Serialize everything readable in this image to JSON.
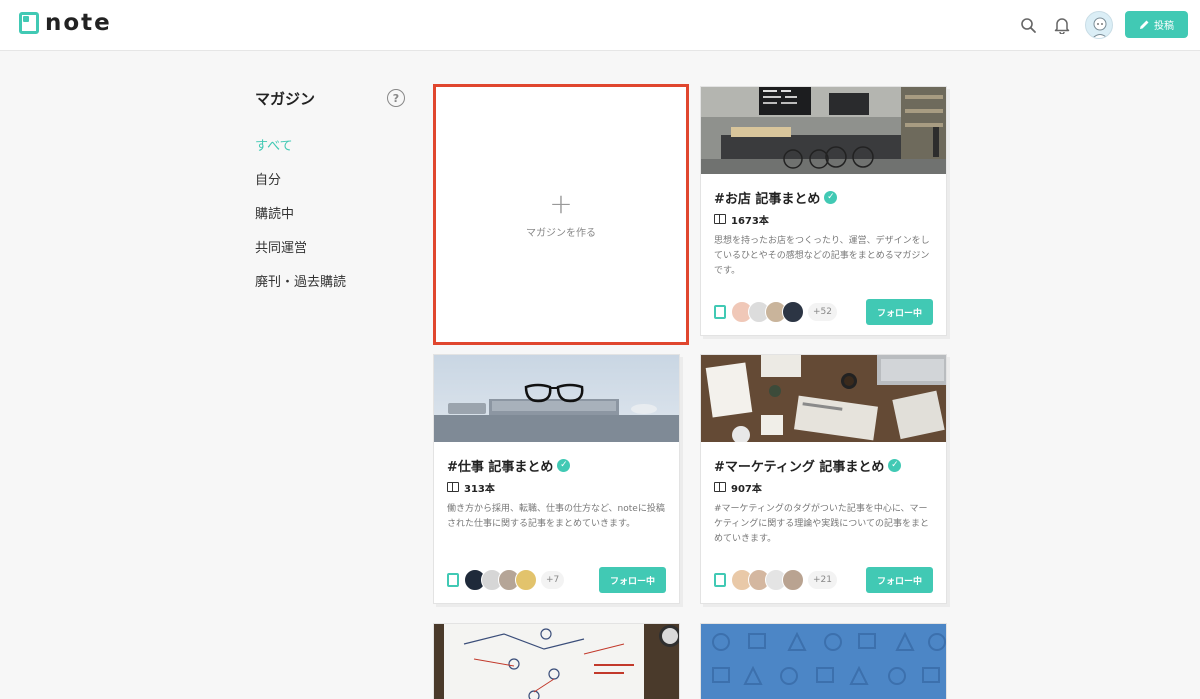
{
  "header": {
    "logo_text": "note",
    "post_button": "投稿",
    "accent_color": "#41c9b4"
  },
  "sidebar": {
    "title": "マガジン",
    "help_icon": "?",
    "items": [
      {
        "label": "すべて",
        "active": true
      },
      {
        "label": "自分"
      },
      {
        "label": "購読中"
      },
      {
        "label": "共同運営"
      },
      {
        "label": "廃刊・過去購読"
      }
    ]
  },
  "create_card": {
    "plus": "+",
    "label": "マガジンを作る"
  },
  "magazines": [
    {
      "title": "#お店 記事まとめ",
      "count": "1673本",
      "description": "思想を持ったお店をつくったり、運営、デザインをしているひとやその感想などの記事をまとめるマガジンです。",
      "member_count": "+52",
      "follow_label": "フォロー中",
      "image": "cafe-photo"
    },
    {
      "title": "#仕事 記事まとめ",
      "count": "313本",
      "description": "働き方から採用、転職、仕事の仕方など、noteに投稿された仕事に関する記事をまとめていきます。",
      "member_count": "+7",
      "follow_label": "フォロー中",
      "image": "glasses-laptop-photo"
    },
    {
      "title": "#マーケティング 記事まとめ",
      "count": "907本",
      "description": "#マーケティングのタグがついた記事を中心に、マーケティングに関する理論や実践についての記事をまとめていきます。",
      "member_count": "+21",
      "follow_label": "フォロー中",
      "image": "desk-newspaper-photo"
    }
  ]
}
